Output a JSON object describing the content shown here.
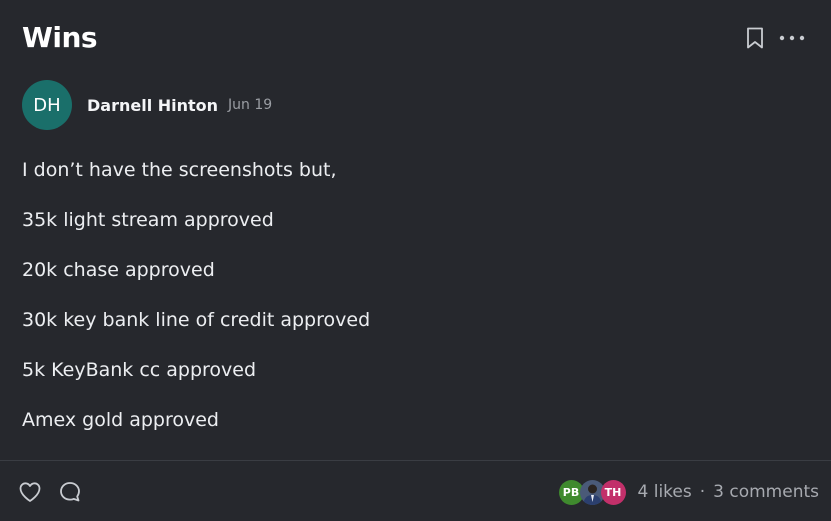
{
  "header": {
    "title": "Wins",
    "bookmark_icon": "bookmark-icon",
    "more_icon": "more-horizontal-icon"
  },
  "author": {
    "initials": "DH",
    "name": "Darnell Hinton",
    "date": "Jun 19",
    "avatar_color": "#1a6f6a"
  },
  "post": {
    "lines": [
      "I don’t have the screenshots but,",
      "35k light stream approved",
      "20k chase approved",
      "30k key bank line of credit approved",
      "5k KeyBank cc approved",
      "Amex gold approved"
    ]
  },
  "footer": {
    "like_icon": "heart-icon",
    "comment_icon": "comment-icon",
    "likers": [
      {
        "initials": "PB",
        "color": "#3f8a2e"
      },
      {
        "initials": "",
        "color": "#3b4a63",
        "kind": "photo"
      },
      {
        "initials": "TH",
        "color": "#c2306a"
      }
    ],
    "likes_text": "4 likes",
    "separator": "·",
    "comments_text": "3 comments"
  },
  "colors": {
    "background": "#26282d",
    "divider": "#3a3d43",
    "muted_text": "#a7aab0"
  }
}
